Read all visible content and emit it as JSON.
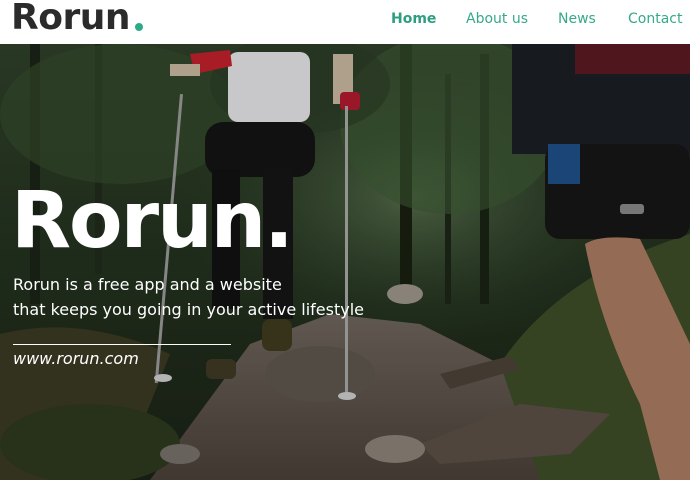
{
  "brand": {
    "logo_text": "Rorun",
    "accent": "#2cab8a"
  },
  "nav": {
    "items": [
      {
        "label": "Home",
        "active": true
      },
      {
        "label": "About us",
        "active": false
      },
      {
        "label": "News",
        "active": false
      },
      {
        "label": "Contact",
        "active": false
      }
    ],
    "color": "#35a98a"
  },
  "hero": {
    "title": "Rorun.",
    "tagline_line1": "Rorun is a free app and a website",
    "tagline_line2": "that keeps you going in your active lifestyle",
    "url": "www.rorun.com",
    "image": "trail-runners-forest-photo"
  }
}
